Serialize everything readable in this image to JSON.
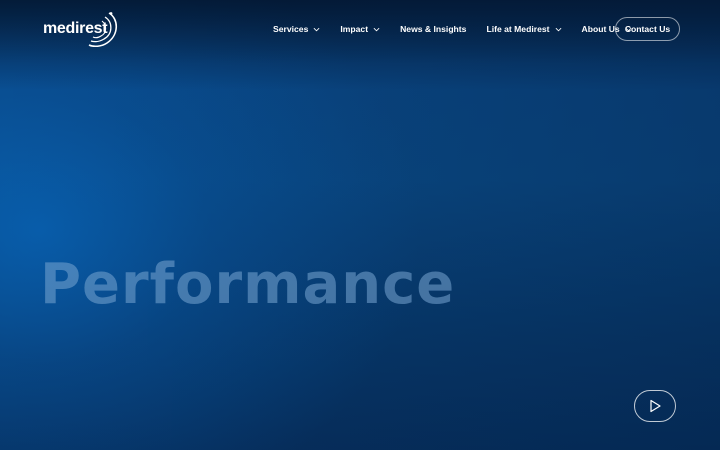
{
  "brand": {
    "name": "medirest"
  },
  "nav": {
    "items": [
      {
        "label": "Services",
        "dropdown": true
      },
      {
        "label": "Impact",
        "dropdown": true
      },
      {
        "label": "News & Insights",
        "dropdown": false
      },
      {
        "label": "Life at Medirest",
        "dropdown": true
      },
      {
        "label": "About Us",
        "dropdown": true
      }
    ],
    "contact_label": "Contact Us"
  },
  "hero": {
    "headline": "Performance",
    "play_icon": "play-icon"
  },
  "colors": {
    "background": "#0a4785",
    "headline": "#78a5d2",
    "text": "#ffffff"
  }
}
